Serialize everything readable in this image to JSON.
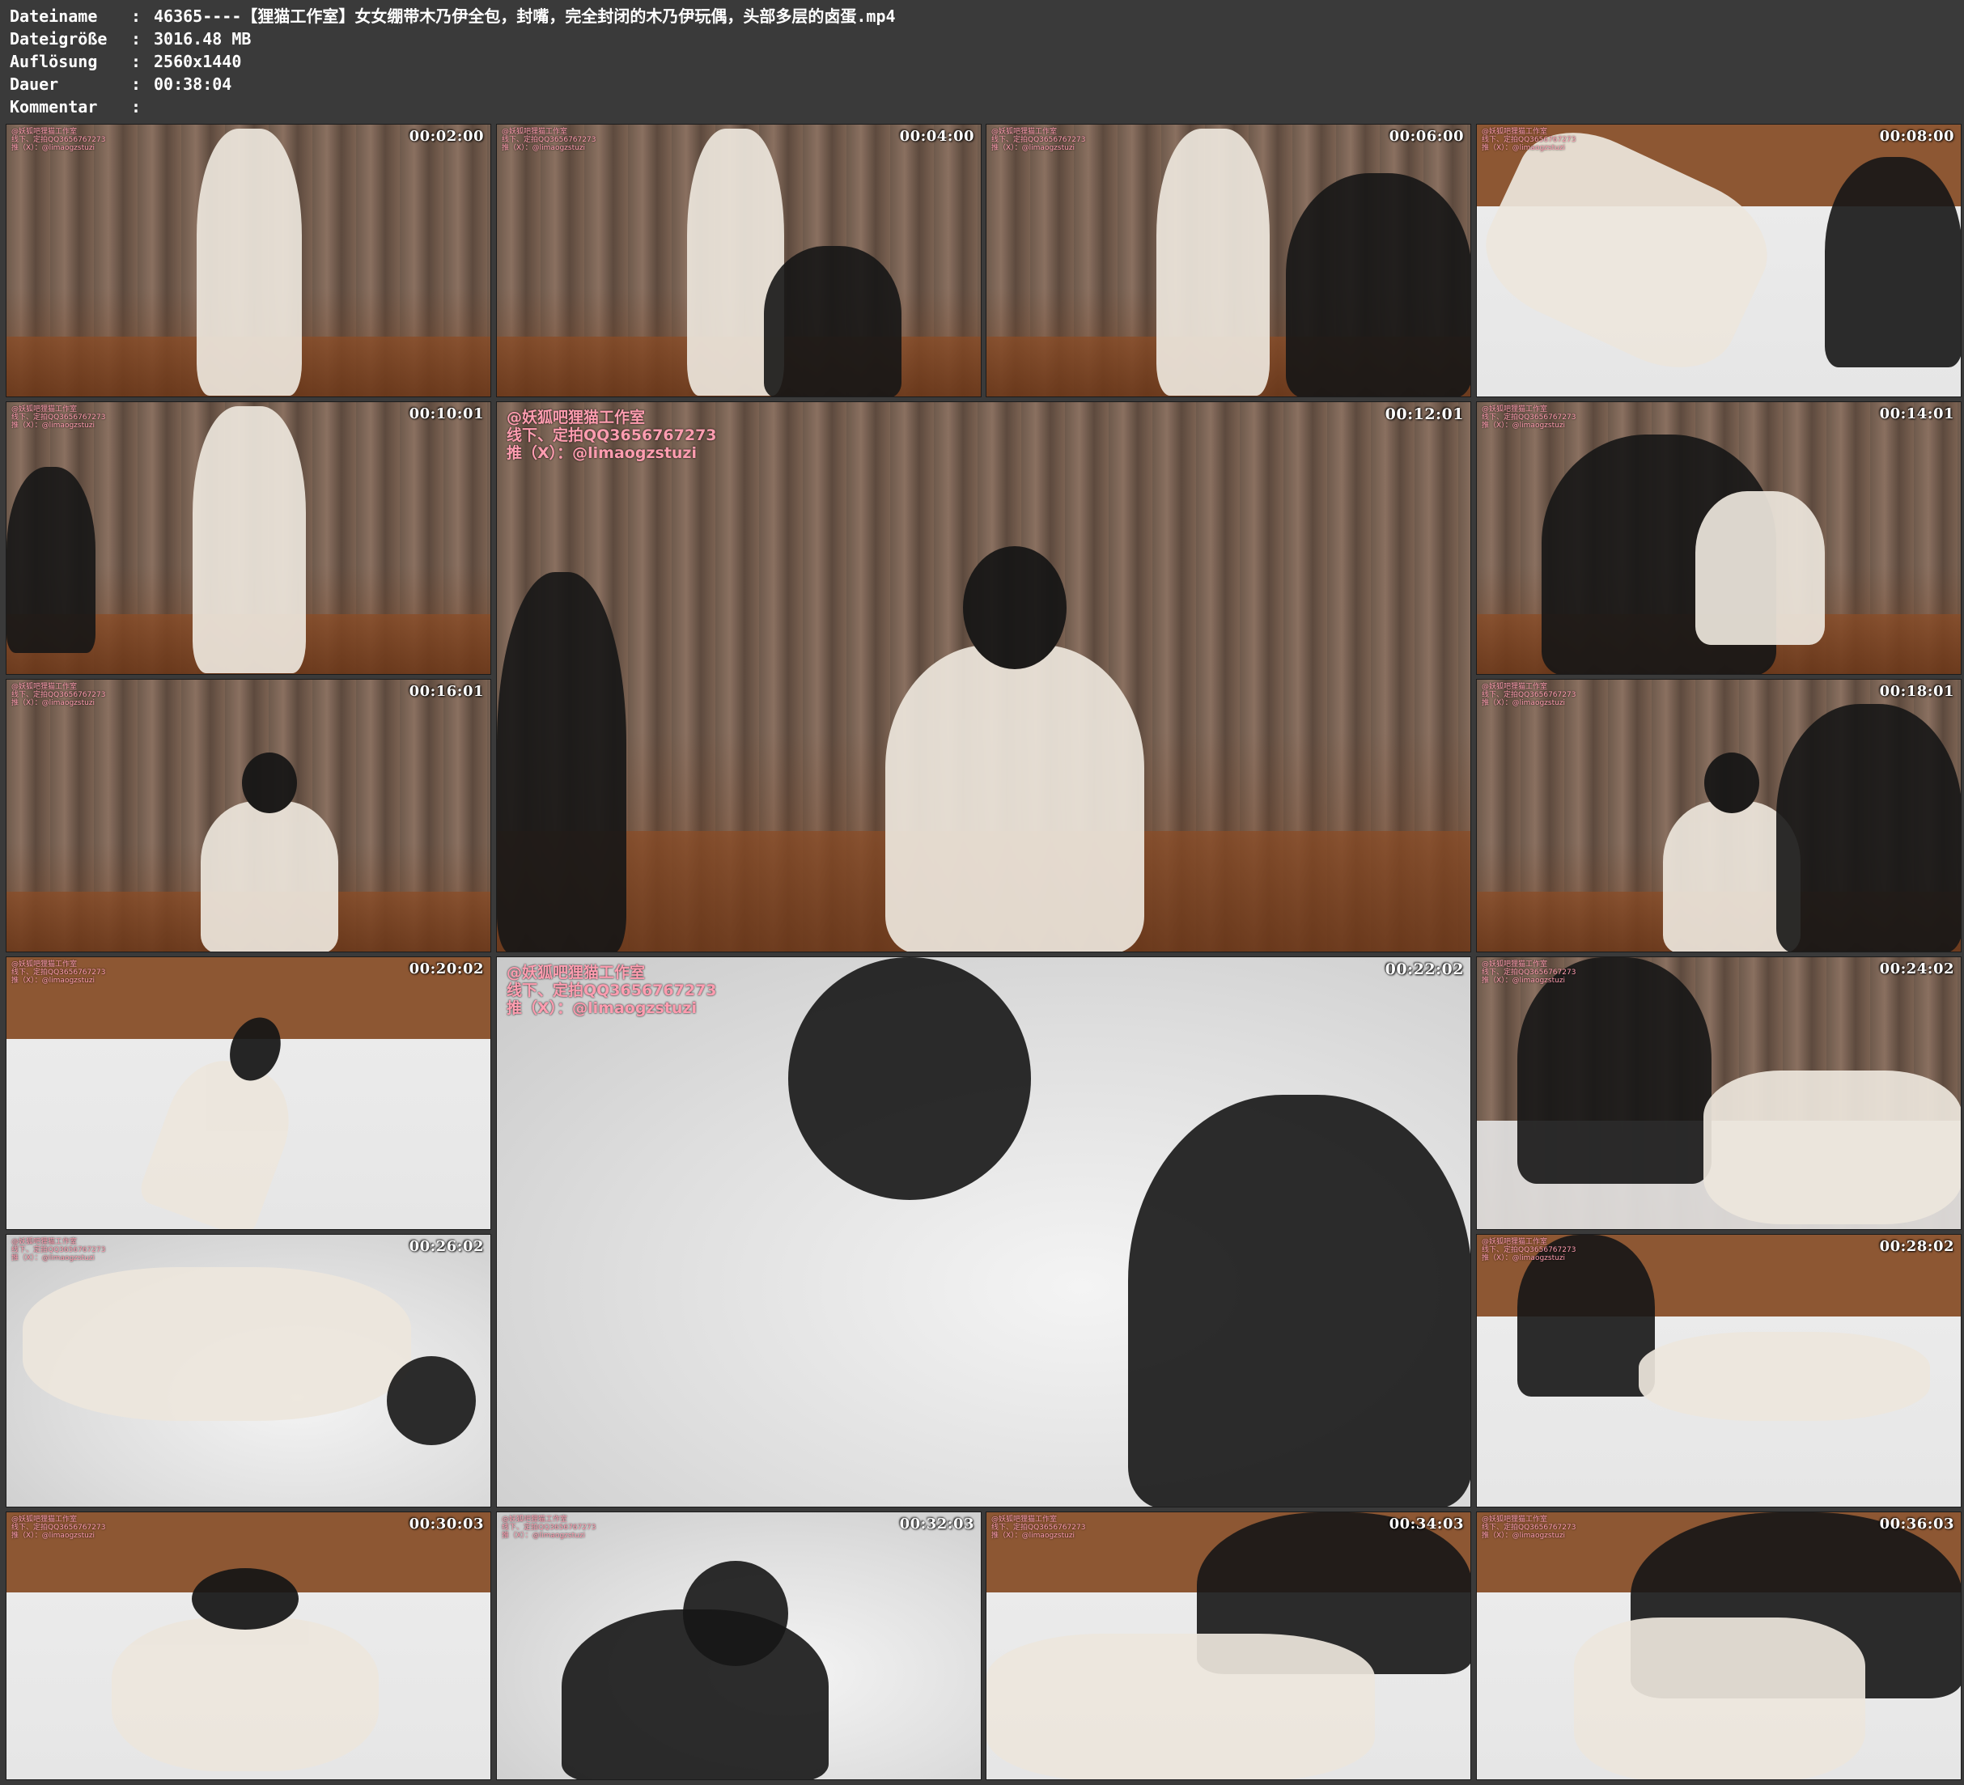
{
  "header": {
    "rows": [
      {
        "key": "Dateiname",
        "sep": ":",
        "value": "46365----【狸猫工作室】女女绷带木乃伊全包，封嘴，完全封闭的木乃伊玩偶，头部多层的卤蛋.mp4"
      },
      {
        "key": "Dateigröße",
        "sep": ":",
        "value": "3016.48 MB"
      },
      {
        "key": "Auflösung",
        "sep": ":",
        "value": "2560x1440"
      },
      {
        "key": "Dauer",
        "sep": ":",
        "value": "00:38:04"
      },
      {
        "key": "Kommentar",
        "sep": ":",
        "value": ""
      }
    ]
  },
  "thumbnails": [
    {
      "time": "00:02:00",
      "scene": "mummy-standing"
    },
    {
      "time": "00:04:00",
      "scene": "mummy-standing-person"
    },
    {
      "time": "00:06:00",
      "scene": "mummy-wrap-person"
    },
    {
      "time": "00:08:00",
      "scene": "legs-bed"
    },
    {
      "time": "00:10:01",
      "scene": "mummy-chair"
    },
    {
      "time": "00:12:01",
      "scene": "black-hood-large"
    },
    {
      "time": "00:14:01",
      "scene": "person-wrapping"
    },
    {
      "time": "00:16:01",
      "scene": "black-hood-chair"
    },
    {
      "time": "00:18:01",
      "scene": "black-hood-person"
    },
    {
      "time": "00:20:02",
      "scene": "mummy-bed"
    },
    {
      "time": "00:22:02",
      "scene": "closeup-large"
    },
    {
      "time": "00:24:02",
      "scene": "person-bed"
    },
    {
      "time": "00:26:02",
      "scene": "mummy-lying"
    },
    {
      "time": "00:28:02",
      "scene": "mummy-lying-person"
    },
    {
      "time": "00:30:03",
      "scene": "mummy-lying-bed"
    },
    {
      "time": "00:32:03",
      "scene": "hand-hood"
    },
    {
      "time": "00:34:03",
      "scene": "vibrator"
    },
    {
      "time": "00:36:03",
      "scene": "person-hood"
    }
  ],
  "watermark": {
    "small": "@妖狐吧狸猫工作室\n线下、定拍QQ3656767273\n推（X）：@limaogzstuzi",
    "large": "@妖狐吧狸猫工作室\n线下、定拍QQ3656767273\n推（X）：@limaogzstuzi"
  }
}
